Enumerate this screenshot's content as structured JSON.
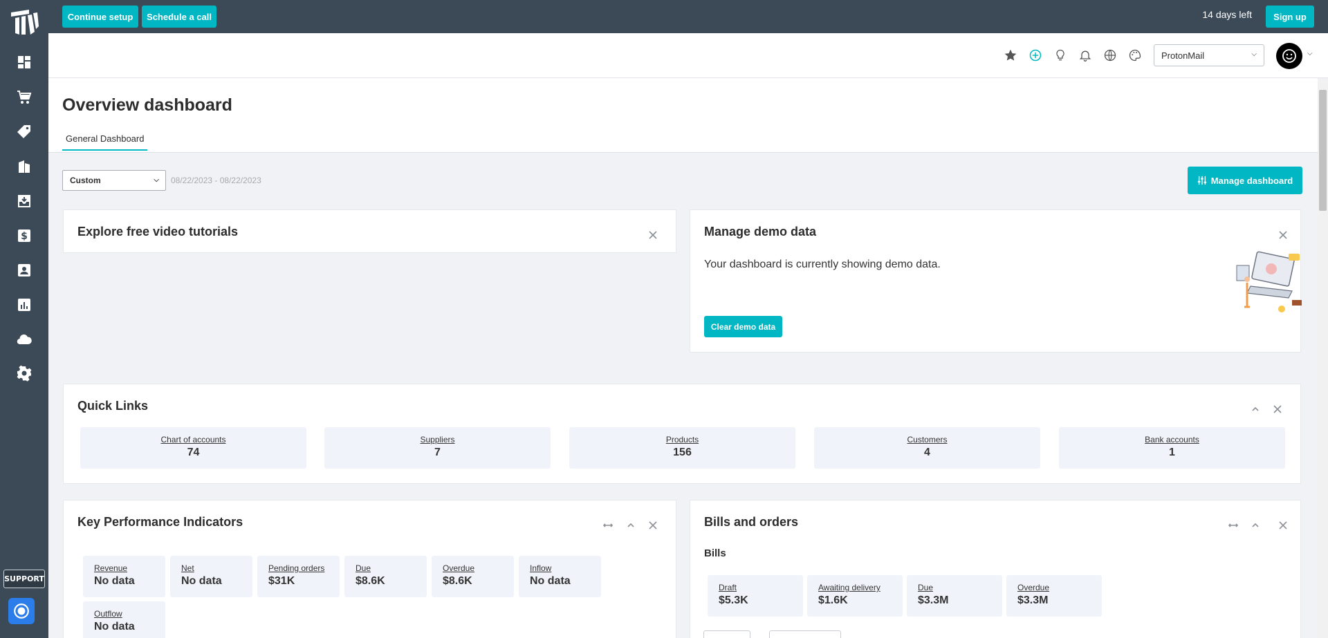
{
  "topbar": {
    "continue_setup": "Continue setup",
    "schedule_call": "Schedule a call",
    "days_left": "14 days left",
    "sign_up": "Sign up"
  },
  "header": {
    "company": "ProtonMail"
  },
  "page": {
    "title": "Overview dashboard",
    "tab": "General Dashboard"
  },
  "filter": {
    "period": "Custom",
    "date_range": "08/22/2023 - 08/22/2023",
    "manage_dashboard": "Manage dashboard"
  },
  "tutorials": {
    "title": "Explore free video tutorials"
  },
  "demo": {
    "title": "Manage demo data",
    "text": "Your dashboard is currently showing demo data.",
    "clear_button": "Clear demo data"
  },
  "quick_links": {
    "title": "Quick Links",
    "items": [
      {
        "label": "Chart of accounts",
        "value": "74"
      },
      {
        "label": "Suppliers",
        "value": "7"
      },
      {
        "label": "Products",
        "value": "156"
      },
      {
        "label": "Customers",
        "value": "4"
      },
      {
        "label": "Bank accounts",
        "value": "1"
      }
    ]
  },
  "kpi": {
    "title": "Key Performance Indicators",
    "items": [
      {
        "label": "Revenue",
        "value": "No data"
      },
      {
        "label": "Net",
        "value": "No data"
      },
      {
        "label": "Pending orders",
        "value": "$31K"
      },
      {
        "label": "Due",
        "value": "$8.6K"
      },
      {
        "label": "Overdue",
        "value": "$8.6K"
      },
      {
        "label": "Inflow",
        "value": "No data"
      },
      {
        "label": "Outflow",
        "value": "No data"
      }
    ]
  },
  "bills": {
    "title": "Bills and orders",
    "subtitle": "Bills",
    "items": [
      {
        "label": "Draft",
        "value": "$5.3K"
      },
      {
        "label": "Awaiting delivery",
        "value": "$1.6K"
      },
      {
        "label": "Due",
        "value": "$3.3M"
      },
      {
        "label": "Overdue",
        "value": "$3.3M"
      }
    ]
  },
  "sidebar": {
    "support": "SUPPORT"
  },
  "colors": {
    "accent": "#00b7c3",
    "sidebar": "#3c4a57",
    "chat": "#2b7de9"
  }
}
